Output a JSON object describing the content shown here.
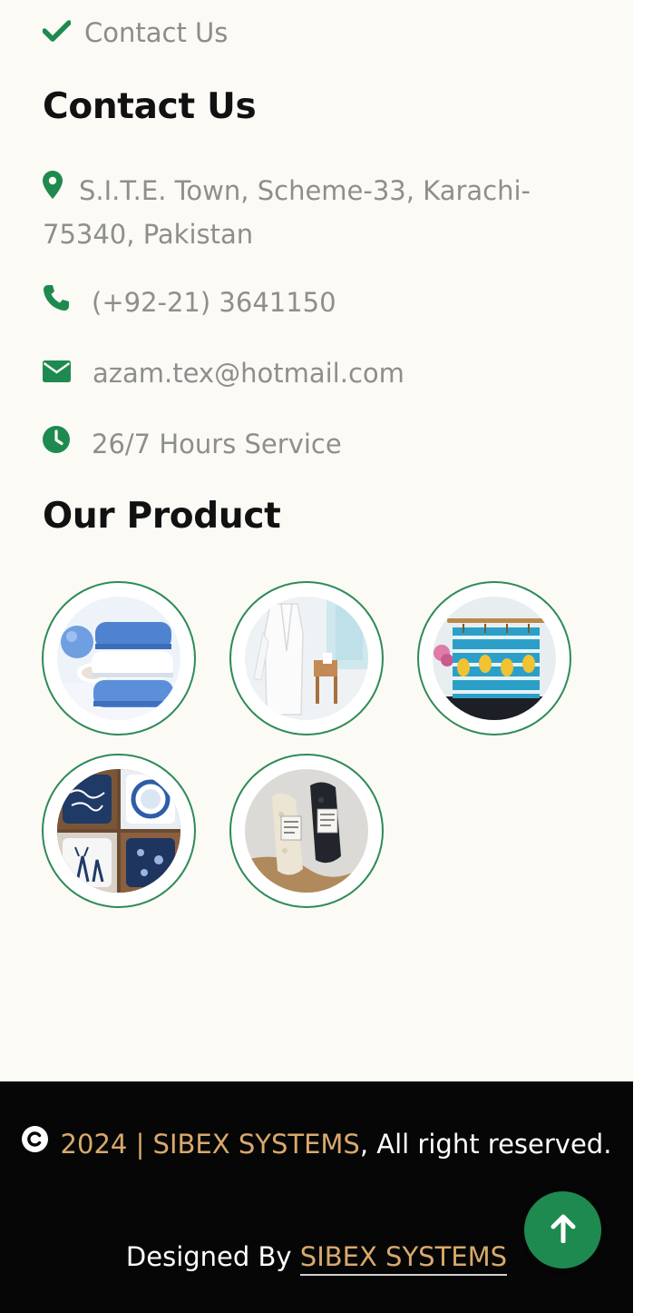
{
  "quick_links": {
    "contact_label": "Contact Us"
  },
  "contact": {
    "heading": "Contact Us",
    "address": "S.I.T.E. Town, Scheme-33, Karachi-75340, Pakistan",
    "phone": "(+92-21) 3641150",
    "email": "azam.tex@hotmail.com",
    "hours": "26/7 Hours Service"
  },
  "products": {
    "heading": "Our Product",
    "items": [
      {
        "icon": "towels-image"
      },
      {
        "icon": "bathrobe-image"
      },
      {
        "icon": "kitchen-towels-image"
      },
      {
        "icon": "cushion-covers-image"
      },
      {
        "icon": "cleaning-cloths-image"
      }
    ]
  },
  "footer": {
    "copyright_year": "2024 | SIBEX SYSTEMS",
    "copyright_rest": ", All right reserved.",
    "designed_prefix": "Designed By ",
    "designed_link": "SIBEX SYSTEMS"
  },
  "colors": {
    "accent": "#1e8a4f",
    "gold": "#d9a96b",
    "footer_bg": "#060606",
    "page_bg": "#fcfaf5"
  }
}
